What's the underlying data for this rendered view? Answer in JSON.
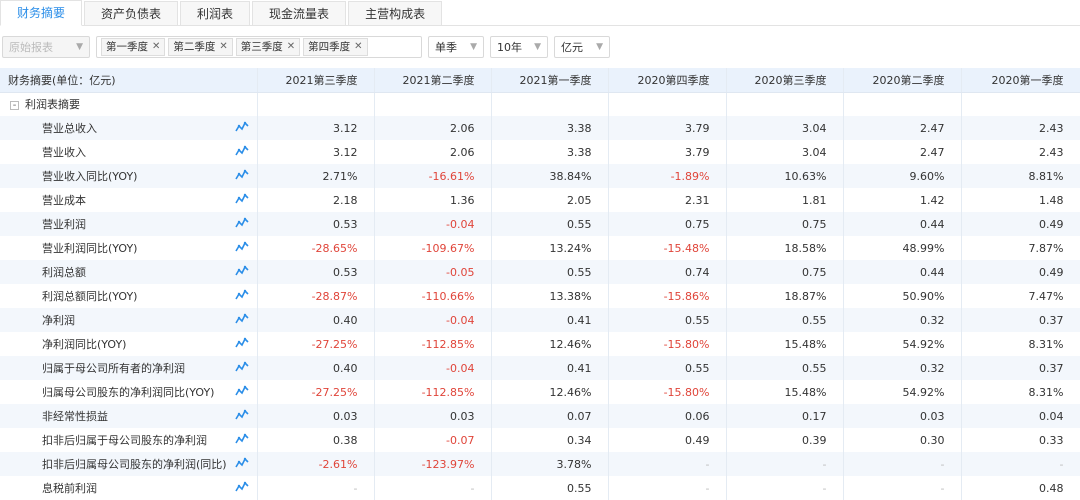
{
  "tabs": [
    "财务摘要",
    "资产负债表",
    "利润表",
    "现金流量表",
    "主营构成表"
  ],
  "toolbar": {
    "report_type": "原始报表",
    "quarters": [
      "第一季度",
      "第二季度",
      "第三季度",
      "第四季度"
    ],
    "period": "单季",
    "years": "10年",
    "unit": "亿元"
  },
  "table": {
    "first_header": "财务摘要(单位：亿元)",
    "columns": [
      "2021第三季度",
      "2021第二季度",
      "2021第一季度",
      "2020第四季度",
      "2020第三季度",
      "2020第二季度",
      "2020第一季度"
    ],
    "group_label": "利润表摘要",
    "group_toggle": "-",
    "rows": [
      {
        "label": "营业总收入",
        "values": [
          "3.12",
          "2.06",
          "3.38",
          "3.79",
          "3.04",
          "2.47",
          "2.43"
        ]
      },
      {
        "label": "营业收入",
        "values": [
          "3.12",
          "2.06",
          "3.38",
          "3.79",
          "3.04",
          "2.47",
          "2.43"
        ]
      },
      {
        "label": "营业收入同比(YOY)",
        "values": [
          "2.71%",
          "-16.61%",
          "38.84%",
          "-1.89%",
          "10.63%",
          "9.60%",
          "8.81%"
        ]
      },
      {
        "label": "营业成本",
        "values": [
          "2.18",
          "1.36",
          "2.05",
          "2.31",
          "1.81",
          "1.42",
          "1.48"
        ]
      },
      {
        "label": "营业利润",
        "values": [
          "0.53",
          "-0.04",
          "0.55",
          "0.75",
          "0.75",
          "0.44",
          "0.49"
        ]
      },
      {
        "label": "营业利润同比(YOY)",
        "values": [
          "-28.65%",
          "-109.67%",
          "13.24%",
          "-15.48%",
          "18.58%",
          "48.99%",
          "7.87%"
        ]
      },
      {
        "label": "利润总额",
        "values": [
          "0.53",
          "-0.05",
          "0.55",
          "0.74",
          "0.75",
          "0.44",
          "0.49"
        ]
      },
      {
        "label": "利润总额同比(YOY)",
        "values": [
          "-28.87%",
          "-110.66%",
          "13.38%",
          "-15.86%",
          "18.87%",
          "50.90%",
          "7.47%"
        ]
      },
      {
        "label": "净利润",
        "values": [
          "0.40",
          "-0.04",
          "0.41",
          "0.55",
          "0.55",
          "0.32",
          "0.37"
        ]
      },
      {
        "label": "净利润同比(YOY)",
        "values": [
          "-27.25%",
          "-112.85%",
          "12.46%",
          "-15.80%",
          "15.48%",
          "54.92%",
          "8.31%"
        ]
      },
      {
        "label": "归属于母公司所有者的净利润",
        "values": [
          "0.40",
          "-0.04",
          "0.41",
          "0.55",
          "0.55",
          "0.32",
          "0.37"
        ]
      },
      {
        "label": "归属母公司股东的净利润同比(YOY)",
        "values": [
          "-27.25%",
          "-112.85%",
          "12.46%",
          "-15.80%",
          "15.48%",
          "54.92%",
          "8.31%"
        ]
      },
      {
        "label": "非经常性损益",
        "values": [
          "0.03",
          "0.03",
          "0.07",
          "0.06",
          "0.17",
          "0.03",
          "0.04"
        ]
      },
      {
        "label": "扣非后归属于母公司股东的净利润",
        "values": [
          "0.38",
          "-0.07",
          "0.34",
          "0.49",
          "0.39",
          "0.30",
          "0.33"
        ]
      },
      {
        "label": "扣非后归属母公司股东的净利润(同比)",
        "values": [
          "-2.61%",
          "-123.97%",
          "3.78%",
          "-",
          "-",
          "-",
          "-"
        ]
      },
      {
        "label": "息税前利润",
        "values": [
          "-",
          "-",
          "0.55",
          "-",
          "-",
          "-",
          "0.48"
        ]
      }
    ]
  },
  "colors": {
    "accent": "#2b8ee8",
    "negative": "#e0453a",
    "header_bg": "#eaf2fc",
    "alt_row": "#f3f7fc"
  },
  "icons": {
    "trend": "trend-chart-icon",
    "remove": "close-icon",
    "dropdown": "chevron-down-icon"
  }
}
